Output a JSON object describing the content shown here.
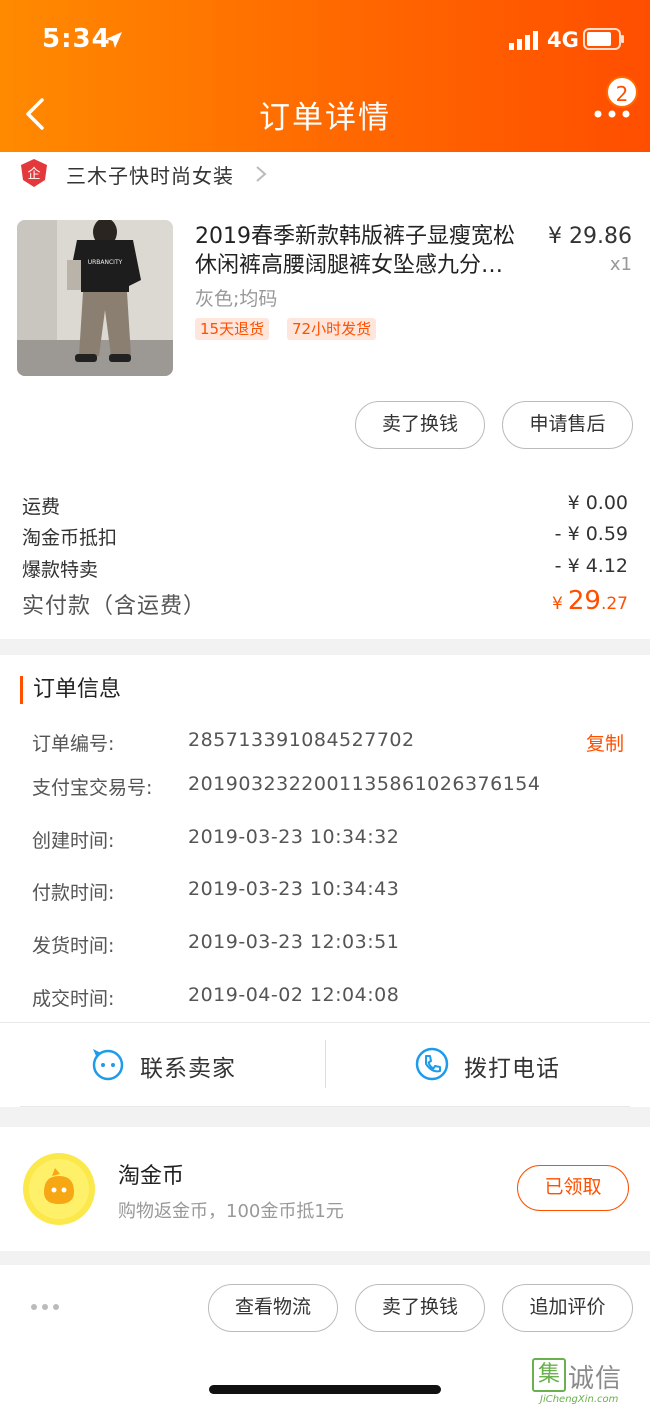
{
  "status_bar": {
    "time": "5:34",
    "network": "4G"
  },
  "nav": {
    "title": "订单详情",
    "badge_count": "2"
  },
  "shop": {
    "name": "三木子快时尚女装"
  },
  "product": {
    "title": "2019春季新款韩版裤子显瘦宽松休闲裤高腰阔腿裤女坠感九分…",
    "price": "¥ 29.86",
    "quantity": "x1",
    "sku": "灰色;均码",
    "tags": [
      "15天退货",
      "72小时发货"
    ],
    "image_text": "URBANCITY"
  },
  "item_actions": {
    "sell_label": "卖了换钱",
    "after_sale_label": "申请售后"
  },
  "fees": [
    {
      "label": "运费",
      "value": "¥ 0.00"
    },
    {
      "label": "淘金币抵扣",
      "value": "- ¥ 0.59"
    },
    {
      "label": "爆款特卖",
      "value": "- ¥ 4.12"
    }
  ],
  "total": {
    "label": "实付款（含运费）",
    "currency": "¥",
    "integer": "29",
    "decimal": ".27"
  },
  "order_info": {
    "title": "订单信息",
    "copy_label": "复制",
    "rows": [
      {
        "label": "订单编号:",
        "value": "285713391084527702"
      },
      {
        "label": "支付宝交易号:",
        "value": "2019032322001135861026376154"
      },
      {
        "label": "创建时间:",
        "value": "2019-03-23 10:34:32"
      },
      {
        "label": "付款时间:",
        "value": "2019-03-23 10:34:43"
      },
      {
        "label": "发货时间:",
        "value": "2019-03-23 12:03:51"
      },
      {
        "label": "成交时间:",
        "value": "2019-04-02 12:04:08"
      }
    ]
  },
  "contact": {
    "seller_label": "联系卖家",
    "call_label": "拨打电话"
  },
  "coins": {
    "title": "淘金币",
    "subtitle": "购物返金币，100金币抵1元",
    "button_label": "已领取"
  },
  "bottom_bar": {
    "logistics_label": "查看物流",
    "sell_label": "卖了换钱",
    "review_label": "追加评价"
  },
  "watermark": {
    "mark": "集",
    "text": "诚信",
    "url": "JiChengXin.com"
  },
  "colors": {
    "accent": "#ff5000",
    "header_start": "#ff8a00",
    "header_end": "#ff4e00"
  }
}
